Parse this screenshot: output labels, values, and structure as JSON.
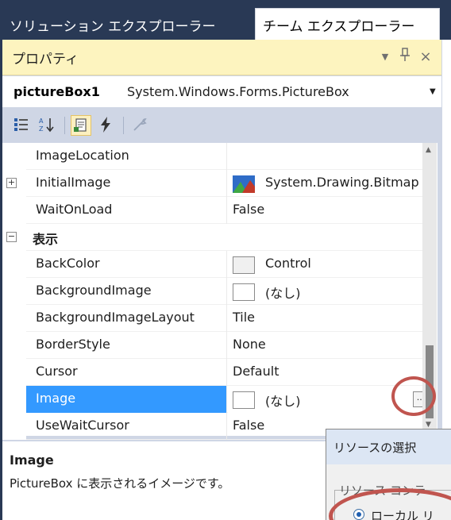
{
  "tabs": {
    "solution_explorer": "ソリューション エクスプローラー",
    "team_explorer": "チーム エクスプローラー"
  },
  "panel": {
    "title": "プロパティ",
    "menu_glyph": "▼",
    "pin_glyph": "ᚘ",
    "close_glyph": "×"
  },
  "selector": {
    "object_name": "pictureBox1",
    "object_type": "System.Windows.Forms.PictureBox",
    "dropdown_glyph": "▼"
  },
  "toolbar": {
    "items": [
      "categorized-icon",
      "alphabetical-icon",
      "properties-icon",
      "events-icon",
      "property-pages-icon"
    ]
  },
  "grid": {
    "rows": [
      {
        "name": "ImageLocation",
        "value": ""
      },
      {
        "name": "InitialImage",
        "value": "System.Drawing.Bitmap",
        "expander": "⊞"
      },
      {
        "name": "WaitOnLoad",
        "value": "False"
      },
      {
        "name": "表示",
        "value": "",
        "expander": "⊟"
      },
      {
        "name": "BackColor",
        "value": "Control"
      },
      {
        "name": "BackgroundImage",
        "value": "(なし)"
      },
      {
        "name": "BackgroundImageLayout",
        "value": "Tile"
      },
      {
        "name": "BorderStyle",
        "value": "None"
      },
      {
        "name": "Cursor",
        "value": "Default"
      },
      {
        "name": "Image",
        "value": "(なし)",
        "ellipsis": "..."
      },
      {
        "name": "UseWaitCursor",
        "value": "False"
      }
    ]
  },
  "colors": {
    "accent": "#3399ff",
    "annotation": "#c0554f",
    "title_bar": "#fdf4bf"
  },
  "description": {
    "title": "Image",
    "text": "PictureBox に表示されるイメージです。"
  },
  "dialog": {
    "title": "リソースの選択",
    "group_label": "リソース コンテ",
    "radio_label": "ローカル リ"
  }
}
